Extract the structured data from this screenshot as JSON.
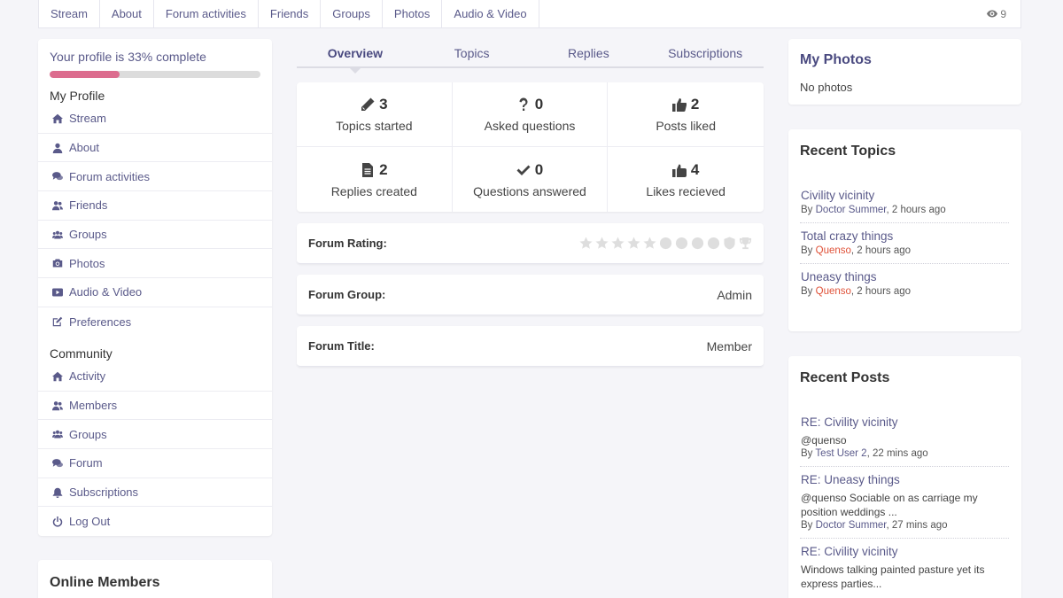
{
  "topnav": {
    "items": [
      "Stream",
      "About",
      "Forum activities",
      "Friends",
      "Groups",
      "Photos",
      "Audio & Video"
    ],
    "views": "9"
  },
  "profile": {
    "progress_label": "Your profile is 33% complete",
    "progress_percent": 33,
    "progress_color": "#dc6c8e"
  },
  "my_profile": {
    "heading": "My Profile",
    "items": [
      {
        "label": "Stream",
        "icon": "home-icon"
      },
      {
        "label": "About",
        "icon": "user-icon"
      },
      {
        "label": "Forum activities",
        "icon": "comments-icon"
      },
      {
        "label": "Friends",
        "icon": "user-friends-icon"
      },
      {
        "label": "Groups",
        "icon": "group-icon"
      },
      {
        "label": "Photos",
        "icon": "camera-icon"
      },
      {
        "label": "Audio & Video",
        "icon": "video-icon"
      },
      {
        "label": "Preferences",
        "icon": "edit-icon"
      }
    ]
  },
  "community": {
    "heading": "Community",
    "items": [
      {
        "label": "Activity",
        "icon": "home-icon"
      },
      {
        "label": "Members",
        "icon": "user-friends-icon"
      },
      {
        "label": "Groups",
        "icon": "group-icon"
      },
      {
        "label": "Forum",
        "icon": "comments-icon"
      },
      {
        "label": "Subscriptions",
        "icon": "bell-icon"
      },
      {
        "label": "Log Out",
        "icon": "power-icon"
      }
    ]
  },
  "online_members": {
    "title": "Online Members"
  },
  "tabs": [
    {
      "label": "Overview",
      "active": true
    },
    {
      "label": "Topics",
      "active": false
    },
    {
      "label": "Replies",
      "active": false
    },
    {
      "label": "Subscriptions",
      "active": false
    }
  ],
  "stats": [
    {
      "value": "3",
      "label": "Topics started",
      "icon": "pencil-icon"
    },
    {
      "value": "0",
      "label": "Asked questions",
      "icon": "question-icon"
    },
    {
      "value": "2",
      "label": "Posts liked",
      "icon": "thumbs-up-icon"
    },
    {
      "value": "2",
      "label": "Replies created",
      "icon": "file-text-icon"
    },
    {
      "value": "0",
      "label": "Questions answered",
      "icon": "check-icon"
    },
    {
      "value": "4",
      "label": "Likes recieved",
      "icon": "thumbs-up-hand-icon"
    }
  ],
  "forum": {
    "rating_label": "Forum Rating:",
    "rating_icons": [
      "star-icon",
      "star-icon",
      "star-icon",
      "star-icon",
      "star-icon",
      "circle-icon",
      "circle-icon",
      "circle-icon",
      "circle-icon",
      "shield-icon",
      "trophy-icon"
    ],
    "group_label": "Forum Group:",
    "group_value": "Admin",
    "title_label": "Forum Title:",
    "title_value": "Member"
  },
  "my_photos": {
    "title": "My Photos",
    "empty_text": "No photos"
  },
  "recent_topics": {
    "title": "Recent Topics",
    "items": [
      {
        "title": "Civility vicinity",
        "by": "By ",
        "author": "Doctor Summer",
        "author_color": "#5a5a8a",
        "time": ", 2 hours ago"
      },
      {
        "title": "Total crazy things",
        "by": "By ",
        "author": "Quenso",
        "author_color": "#e0533a",
        "time": ", 2 hours ago"
      },
      {
        "title": "Uneasy things",
        "by": "By ",
        "author": "Quenso",
        "author_color": "#e0533a",
        "time": ", 2 hours ago"
      }
    ]
  },
  "recent_posts": {
    "title": "Recent Posts",
    "items": [
      {
        "title": "RE: Civility vicinity",
        "excerpt": "@quenso",
        "by": "By ",
        "author": "Test User 2",
        "time": ", 22 mins ago"
      },
      {
        "title": "RE: Uneasy things",
        "excerpt": "@quenso Sociable on as carriage my position weddings ...",
        "by": "By ",
        "author": "Doctor Summer",
        "time": ", 27 mins ago"
      },
      {
        "title": "RE: Civility vicinity",
        "excerpt": "Windows talking painted pasture yet its express parties...",
        "by": "",
        "author": "",
        "time": ""
      }
    ]
  },
  "colors": {
    "accent": "#5a5a8a",
    "author_highlight": "#e0533a",
    "background": "#f5f5f9"
  }
}
